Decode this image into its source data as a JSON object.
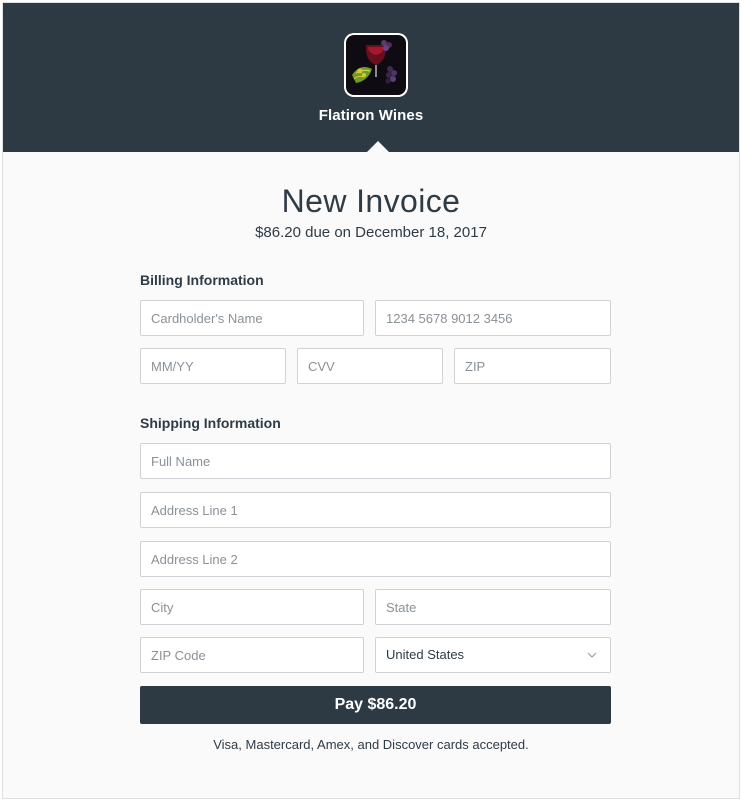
{
  "header": {
    "merchant_name": "Flatiron Wines",
    "logo_icon": "wine-grapes-logo",
    "background_color": "#2d3a44"
  },
  "invoice": {
    "title": "New Invoice",
    "due_text": "$86.20 due on December 18, 2017"
  },
  "billing": {
    "heading": "Billing Information",
    "cardholder_placeholder": "Cardholder's Name",
    "card_number_placeholder": "1234 5678 9012 3456",
    "expiry_placeholder": "MM/YY",
    "cvv_placeholder": "CVV",
    "zip_placeholder": "ZIP"
  },
  "shipping": {
    "heading": "Shipping Information",
    "full_name_placeholder": "Full Name",
    "address1_placeholder": "Address Line 1",
    "address2_placeholder": "Address Line 2",
    "city_placeholder": "City",
    "state_placeholder": "State",
    "zip_placeholder": "ZIP Code",
    "country_selected": "United States",
    "country_icon": "chevron-down-icon"
  },
  "actions": {
    "pay_label": "Pay $86.20",
    "accepted_cards_note": "Visa, Mastercard, Amex, and Discover cards accepted."
  }
}
